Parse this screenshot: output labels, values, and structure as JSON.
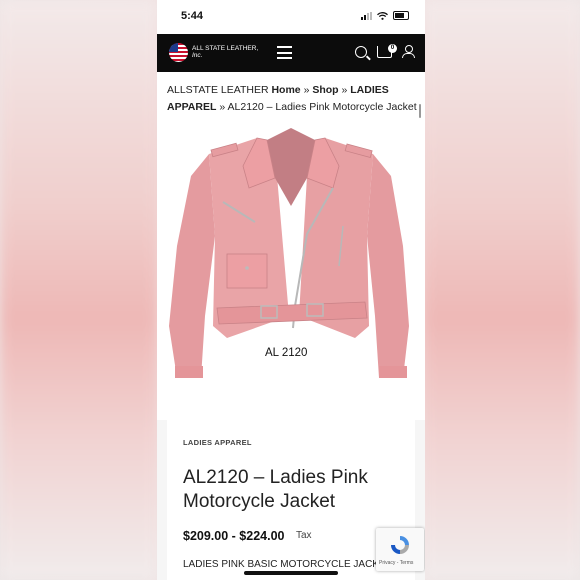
{
  "status_bar": {
    "time": "5:44"
  },
  "header": {
    "brand_line1": "ALL STATE LEATHER,",
    "brand_line2": "Inc.",
    "cart_count": "0"
  },
  "breadcrumb": {
    "site": "ALLSTATE LEATHER",
    "home": "Home",
    "sep": "»",
    "shop": "Shop",
    "category": "LADIES APPAREL",
    "current": "AL2120 – Ladies Pink Motorcycle Jacket"
  },
  "image": {
    "caption": "AL 2120",
    "jacket_color": "#e7a0a3"
  },
  "product": {
    "category": "LADIES APPAREL",
    "title": "AL2120 – Ladies Pink Motorcycle Jacket",
    "price": "$209.00 - $224.00",
    "tax": "Tax",
    "description": "LADIES PINK BASIC MOTORCYCLE JACK"
  },
  "recaptcha": {
    "links": "Privacy - Terms"
  }
}
